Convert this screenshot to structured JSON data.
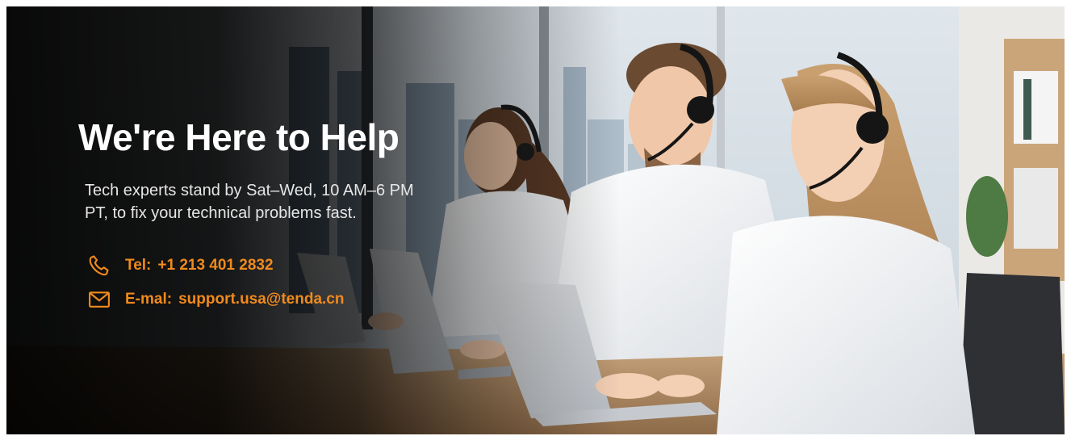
{
  "hero": {
    "headline": "We're Here to Help",
    "subtext_line1": "Tech experts stand by Sat–Wed, 10 AM–6 PM",
    "subtext_line2": "PT, to fix your technical problems fast.",
    "phone_icon": "phone-icon",
    "phone_label": "Tel:",
    "phone_value": "+1 213 401 2832",
    "email_icon": "mail-icon",
    "email_label": "E-mal:",
    "email_value": "support.usa@tenda.cn"
  },
  "colors": {
    "accent": "#f08a1c",
    "headline": "#ffffff",
    "body_text": "#e6e6e6"
  }
}
